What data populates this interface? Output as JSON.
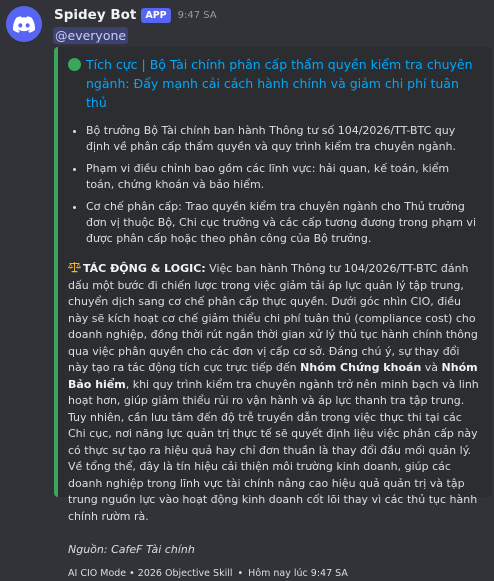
{
  "message": {
    "author": "Spidey Bot",
    "badge": "APP",
    "time": "9:47 SA",
    "mention": "@everyone"
  },
  "embed": {
    "accent_color": "#3ba55d",
    "title_icon": "green-circle-icon",
    "title": "Tích cực | Bộ Tài chính phân cấp thẩm quyền kiểm tra chuyên ngành: Đẩy mạnh cải cách hành chính và giảm chi phí tuân thủ",
    "bullets": [
      "Bộ trưởng Bộ Tài chính ban hành Thông tư số 104/2026/TT-BTC quy định về phân cấp thẩm quyền và quy trình kiểm tra chuyên ngành.",
      "Phạm vi điều chỉnh bao gồm các lĩnh vực: hải quan, kế toán, kiểm toán, chứng khoán và bảo hiểm.",
      "Cơ chế phân cấp: Trao quyền kiểm tra chuyên ngành cho Thủ trưởng đơn vị thuộc Bộ, Chi cục trưởng và các cấp tương đương trong phạm vi được phân cấp hoặc theo phân công của Bộ trưởng."
    ],
    "analysis_icon": "scales-icon",
    "analysis_label": "TÁC ĐỘNG & LOGIC:",
    "analysis_part1": " Việc ban hành Thông tư 104/2026/TT-BTC đánh dấu một bước đi chiến lược trong việc giảm tải áp lực quản lý tập trung, chuyển dịch sang cơ chế phân cấp thực quyền. Dưới góc nhìn CIO, điều này sẽ kích hoạt cơ chế giảm thiểu chi phí tuân thủ (compliance cost) cho doanh nghiệp, đồng thời rút ngắn thời gian xử lý thủ tục hành chính thông qua việc phân quyền cho các đơn vị cấp cơ sở. Đáng chú ý, sự thay đổi này tạo ra tác động tích cực trực tiếp đến ",
    "analysis_bold1": "Nhóm Chứng khoán",
    "analysis_part2": " và ",
    "analysis_bold2": "Nhóm Bảo hiểm",
    "analysis_part3": ", khi quy trình kiểm tra chuyên ngành trở nên minh bạch và linh hoạt hơn, giúp giảm thiểu rủi ro vận hành và áp lực thanh tra tập trung. Tuy nhiên, cần lưu tâm đến độ trễ truyền dẫn trong việc thực thi tại các Chi cục, nơi năng lực quản trị thực tế sẽ quyết định liệu việc phân cấp này có thực sự tạo ra hiệu quả hay chỉ đơn thuần là thay đổi đầu mối quản lý. Về tổng thể, đây là tín hiệu cải thiện môi trường kinh doanh, giúp các doanh nghiệp trong lĩnh vực tài chính nâng cao hiệu quả quản trị và tập trung nguồn lực vào hoạt động kinh doanh cốt lõi thay vì các thủ tục hành chính rườm rà.",
    "source": "Nguồn: CafeF Tài chính",
    "footer_text": "AI CIO Mode • 2026 Objective Skill",
    "footer_sep": "•",
    "footer_time": "Hôm nay lúc 9:47 SA"
  }
}
